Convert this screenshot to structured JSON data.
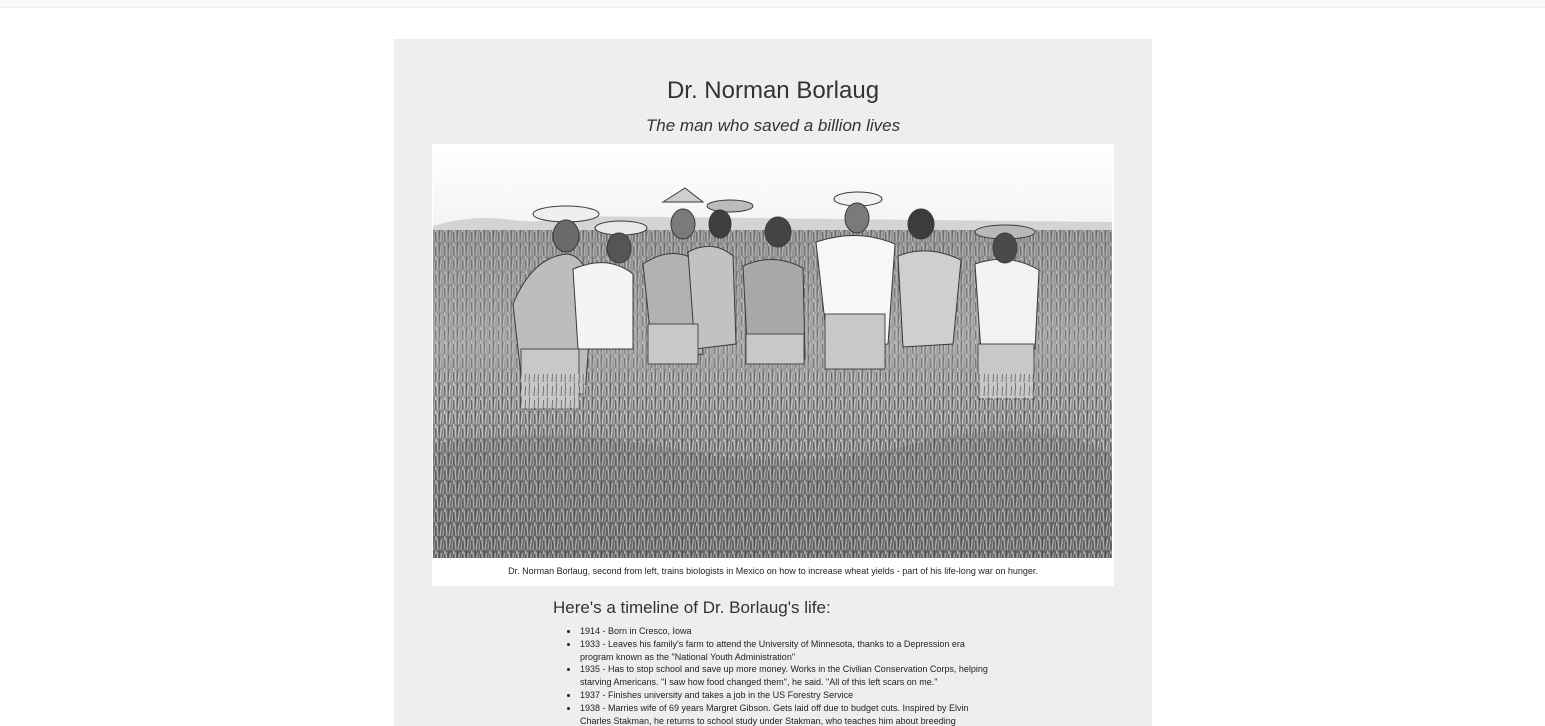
{
  "page": {
    "title": "Dr. Norman Borlaug",
    "subtitle": "The man who saved a billion lives"
  },
  "figure": {
    "image": "black-and-white photo of nine men standing in a wheat field",
    "caption": "Dr. Norman Borlaug, second from left, trains biologists in Mexico on how to increase wheat yields - part of his life-long war on hunger."
  },
  "timeline": {
    "heading": "Here's a timeline of Dr. Borlaug's life:",
    "events": [
      {
        "text": "1914 - Born in Cresco, Iowa"
      },
      {
        "text": "1933 - Leaves his family's farm to attend the University of Minnesota, thanks to a Depression era program known as the \"National Youth Administration\""
      },
      {
        "text": "1935 - Has to stop school and save up more money. Works in the Civilian Conservation Corps, helping starving Americans. \"I saw how food changed them\", he said. \"All of this left scars on me.\""
      },
      {
        "text": "1937 - Finishes university and takes a job in the US Forestry Service"
      },
      {
        "text": "1938 - Marries wife of 69 years Margret Gibson. Gets laid off due to budget cuts. Inspired by Elvin Charles Stakman, he returns to school study under Stakman, who teaches him about breeding"
      }
    ]
  },
  "colors": {
    "page_bg": "#ffffff",
    "card_bg": "#eeeeee",
    "text": "#333333"
  }
}
